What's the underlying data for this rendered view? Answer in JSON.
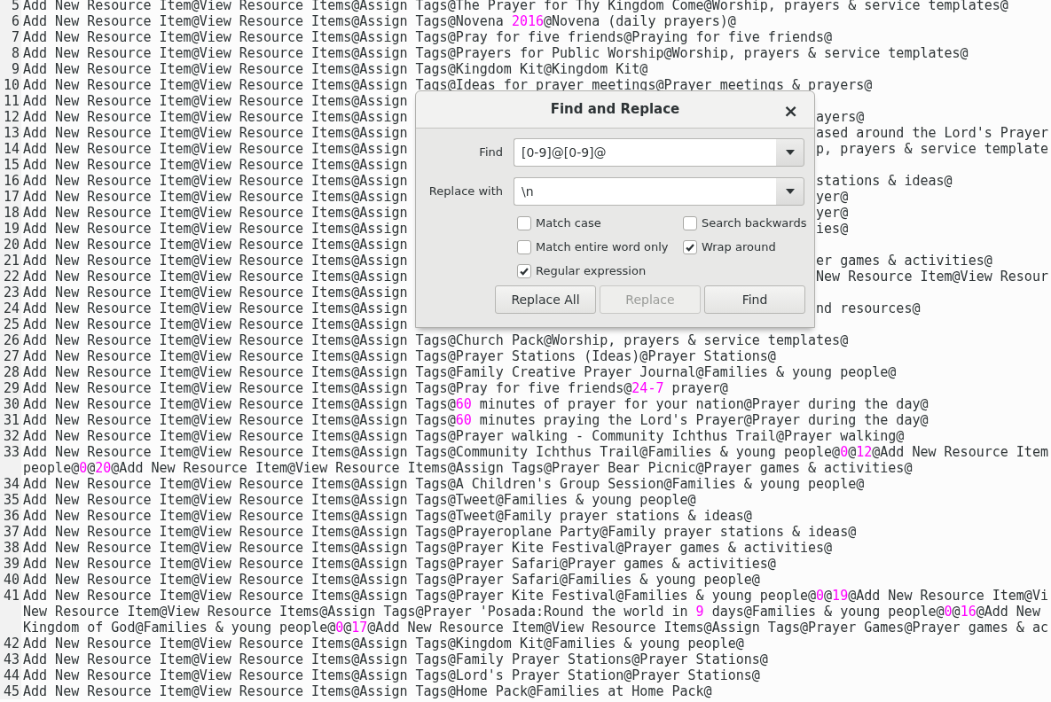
{
  "editor": {
    "lines": [
      {
        "number": "5",
        "rows": [
          {
            "segments": [
              "Add New Resource Item@View Resource Items@Assign Tags@The Prayer for Thy Kingdom Come@Worship, prayers & service templates@"
            ]
          }
        ]
      },
      {
        "number": "6",
        "rows": [
          {
            "segments": [
              "Add New Resource Item@View Resource Items@Assign Tags@Novena ",
              {
                "text": "2016",
                "kind": "number"
              },
              "@Novena (daily prayers)@"
            ]
          }
        ]
      },
      {
        "number": "7",
        "rows": [
          {
            "segments": [
              "Add New Resource Item@View Resource Items@Assign Tags@Pray for five friends@Praying for five friends@"
            ]
          }
        ]
      },
      {
        "number": "8",
        "rows": [
          {
            "segments": [
              "Add New Resource Item@View Resource Items@Assign Tags@Prayers for Public Worship@Worship, prayers & service templates@"
            ]
          }
        ]
      },
      {
        "number": "9",
        "rows": [
          {
            "segments": [
              "Add New Resource Item@View Resource Items@Assign Tags@Kingdom Kit@Kingdom Kit@"
            ]
          }
        ]
      },
      {
        "number": "10",
        "rows": [
          {
            "segments": [
              "Add New Resource Item@View Resource Items@Assign Tags@Ideas for prayer meetings@Prayer meetings & prayers@"
            ]
          }
        ]
      },
      {
        "number": "11",
        "rows": [
          {
            "segments": [
              "Add New Resource Item@View Resource Items@Assign"
            ]
          }
        ]
      },
      {
        "number": "12",
        "rows": [
          {
            "segments": [
              "Add New Resource Item@View Resource Items@Assign",
              {
                "text": "ayers@",
                "kind": "after-dialog"
              }
            ]
          }
        ]
      },
      {
        "number": "13",
        "rows": [
          {
            "segments": [
              "Add New Resource Item@View Resource Items@Assign",
              {
                "text": "ased around the Lord's Prayer",
                "kind": "after-dialog"
              }
            ]
          }
        ]
      },
      {
        "number": "14",
        "rows": [
          {
            "segments": [
              "Add New Resource Item@View Resource Items@Assign",
              {
                "text": "p, prayers & service template",
                "kind": "after-dialog"
              }
            ]
          }
        ]
      },
      {
        "number": "15",
        "rows": [
          {
            "segments": [
              "Add New Resource Item@View Resource Items@Assign"
            ]
          }
        ]
      },
      {
        "number": "16",
        "rows": [
          {
            "segments": [
              "Add New Resource Item@View Resource Items@Assign",
              {
                "text": "stations & ideas@",
                "kind": "after-dialog"
              }
            ]
          }
        ]
      },
      {
        "number": "17",
        "rows": [
          {
            "segments": [
              "Add New Resource Item@View Resource Items@Assign",
              {
                "text": "yer@",
                "kind": "after-dialog"
              }
            ]
          }
        ]
      },
      {
        "number": "18",
        "rows": [
          {
            "segments": [
              "Add New Resource Item@View Resource Items@Assign",
              {
                "text": "yer@",
                "kind": "after-dialog"
              }
            ]
          }
        ]
      },
      {
        "number": "19",
        "rows": [
          {
            "segments": [
              "Add New Resource Item@View Resource Items@Assign",
              {
                "text": "ies@",
                "kind": "after-dialog"
              }
            ]
          }
        ]
      },
      {
        "number": "20",
        "rows": [
          {
            "segments": [
              "Add New Resource Item@View Resource Items@Assign"
            ]
          }
        ]
      },
      {
        "number": "21",
        "rows": [
          {
            "segments": [
              "Add New Resource Item@View Resource Items@Assign",
              {
                "text": "er games & activities@",
                "kind": "after-dialog"
              }
            ]
          }
        ]
      },
      {
        "number": "22",
        "rows": [
          {
            "segments": [
              "Add New Resource Item@View Resource Items@Assign",
              {
                "text": "New Resource Item@View Resour",
                "kind": "after-dialog"
              }
            ]
          }
        ]
      },
      {
        "number": "23",
        "rows": [
          {
            "segments": [
              "Add New Resource Item@View Resource Items@Assign"
            ]
          }
        ]
      },
      {
        "number": "24",
        "rows": [
          {
            "segments": [
              "Add New Resource Item@View Resource Items@Assign",
              {
                "text": "nd resources@",
                "kind": "after-dialog"
              }
            ]
          }
        ]
      },
      {
        "number": "25",
        "rows": [
          {
            "segments": [
              "Add New Resource Item@View Resource Items@Assign"
            ]
          }
        ]
      },
      {
        "number": "26",
        "rows": [
          {
            "segments": [
              "Add New Resource Item@View Resource Items@Assign Tags@Church Pack@Worship, prayers & service templates@"
            ]
          }
        ]
      },
      {
        "number": "27",
        "rows": [
          {
            "segments": [
              "Add New Resource Item@View Resource Items@Assign Tags@Prayer Stations (Ideas)@Prayer Stations@"
            ]
          }
        ]
      },
      {
        "number": "28",
        "rows": [
          {
            "segments": [
              "Add New Resource Item@View Resource Items@Assign Tags@Family Creative Prayer Journal@Families & young people@"
            ]
          }
        ]
      },
      {
        "number": "29",
        "rows": [
          {
            "segments": [
              "Add New Resource Item@View Resource Items@Assign Tags@Pray for five friends@",
              {
                "text": "24-7",
                "kind": "number"
              },
              " prayer@"
            ]
          }
        ]
      },
      {
        "number": "30",
        "rows": [
          {
            "segments": [
              "Add New Resource Item@View Resource Items@Assign Tags@",
              {
                "text": "60",
                "kind": "number"
              },
              " minutes of prayer for your nation@Prayer during the day@"
            ]
          }
        ]
      },
      {
        "number": "31",
        "rows": [
          {
            "segments": [
              "Add New Resource Item@View Resource Items@Assign Tags@",
              {
                "text": "60",
                "kind": "number"
              },
              " minutes praying the Lord's Prayer@Prayer during the day@"
            ]
          }
        ]
      },
      {
        "number": "32",
        "rows": [
          {
            "segments": [
              "Add New Resource Item@View Resource Items@Assign Tags@Prayer walking - Community Ichthus Trail@Prayer walking@"
            ]
          }
        ]
      },
      {
        "number": "33",
        "rows": [
          {
            "segments": [
              "Add New Resource Item@View Resource Items@Assign Tags@Community Ichthus Trail@Families & young people@",
              {
                "text": "0",
                "kind": "number"
              },
              "@",
              {
                "text": "12",
                "kind": "number"
              },
              "@Add New Resource Item"
            ]
          },
          {
            "segments": [
              "people@",
              {
                "text": "0",
                "kind": "number"
              },
              "@",
              {
                "text": "20",
                "kind": "number"
              },
              "@Add New Resource Item@View Resource Items@Assign Tags@Prayer Bear Picnic@Prayer games & activities@"
            ]
          }
        ]
      },
      {
        "number": "34",
        "rows": [
          {
            "segments": [
              "Add New Resource Item@View Resource Items@Assign Tags@A Children's Group Session@Families & young people@"
            ]
          }
        ]
      },
      {
        "number": "35",
        "rows": [
          {
            "segments": [
              "Add New Resource Item@View Resource Items@Assign Tags@Tweet@Families & young people@"
            ]
          }
        ]
      },
      {
        "number": "36",
        "rows": [
          {
            "segments": [
              "Add New Resource Item@View Resource Items@Assign Tags@Tweet@Family prayer stations & ideas@"
            ]
          }
        ]
      },
      {
        "number": "37",
        "rows": [
          {
            "segments": [
              "Add New Resource Item@View Resource Items@Assign Tags@Prayeroplane Party@Family prayer stations & ideas@"
            ]
          }
        ]
      },
      {
        "number": "38",
        "rows": [
          {
            "segments": [
              "Add New Resource Item@View Resource Items@Assign Tags@Prayer Kite Festival@Prayer games & activities@"
            ]
          }
        ]
      },
      {
        "number": "39",
        "rows": [
          {
            "segments": [
              "Add New Resource Item@View Resource Items@Assign Tags@Prayer Safari@Prayer games & activities@"
            ]
          }
        ]
      },
      {
        "number": "40",
        "rows": [
          {
            "segments": [
              "Add New Resource Item@View Resource Items@Assign Tags@Prayer Safari@Families & young people@"
            ]
          }
        ]
      },
      {
        "number": "41",
        "rows": [
          {
            "segments": [
              "Add New Resource Item@View Resource Items@Assign Tags@Prayer Kite Festival@Families & young people@",
              {
                "text": "0",
                "kind": "number"
              },
              "@",
              {
                "text": "19",
                "kind": "number"
              },
              "@Add New Resource Item@Vi"
            ]
          },
          {
            "segments": [
              "New Resource Item@View Resource Items@Assign Tags@Prayer 'Posada:Round the world in ",
              {
                "text": "9",
                "kind": "number"
              },
              " days@Families & young people@",
              {
                "text": "0",
                "kind": "number"
              },
              "@",
              {
                "text": "16",
                "kind": "number"
              },
              "@Add New"
            ]
          },
          {
            "segments": [
              "Kingdom of God@Families & young people@",
              {
                "text": "0",
                "kind": "number"
              },
              "@",
              {
                "text": "17",
                "kind": "number"
              },
              "@Add New Resource Item@View Resource Items@Assign Tags@Prayer Games@Prayer games & ac"
            ]
          }
        ]
      },
      {
        "number": "42",
        "rows": [
          {
            "segments": [
              "Add New Resource Item@View Resource Items@Assign Tags@Kingdom Kit@Families & young people@"
            ]
          }
        ]
      },
      {
        "number": "43",
        "rows": [
          {
            "segments": [
              "Add New Resource Item@View Resource Items@Assign Tags@Family Prayer Stations@Prayer Stations@"
            ]
          }
        ]
      },
      {
        "number": "44",
        "rows": [
          {
            "segments": [
              "Add New Resource Item@View Resource Items@Assign Tags@Lord's Prayer Station@Prayer Stations@"
            ]
          }
        ]
      },
      {
        "number": "45",
        "rows": [
          {
            "segments": [
              "Add New Resource Item@View Resource Items@Assign Tags@Home Pack@Families at Home Pack@"
            ]
          }
        ]
      }
    ]
  },
  "dialog": {
    "title": "Find and Replace",
    "close": "×",
    "fields": [
      {
        "label": "Find",
        "value": "[0-9]@[0-9]@"
      },
      {
        "label": "Replace with",
        "value": "\\n"
      }
    ],
    "options": [
      {
        "label": "Match case",
        "checked": false
      },
      {
        "label": "Search backwards",
        "checked": false
      },
      {
        "label": "Match entire word only",
        "checked": false
      },
      {
        "label": "Wrap around",
        "checked": true
      },
      {
        "label": "Regular expression",
        "checked": true
      }
    ],
    "buttons": [
      {
        "label": "Replace All",
        "disabled": false
      },
      {
        "label": "Replace",
        "disabled": true
      },
      {
        "label": "Find",
        "disabled": false
      }
    ]
  }
}
